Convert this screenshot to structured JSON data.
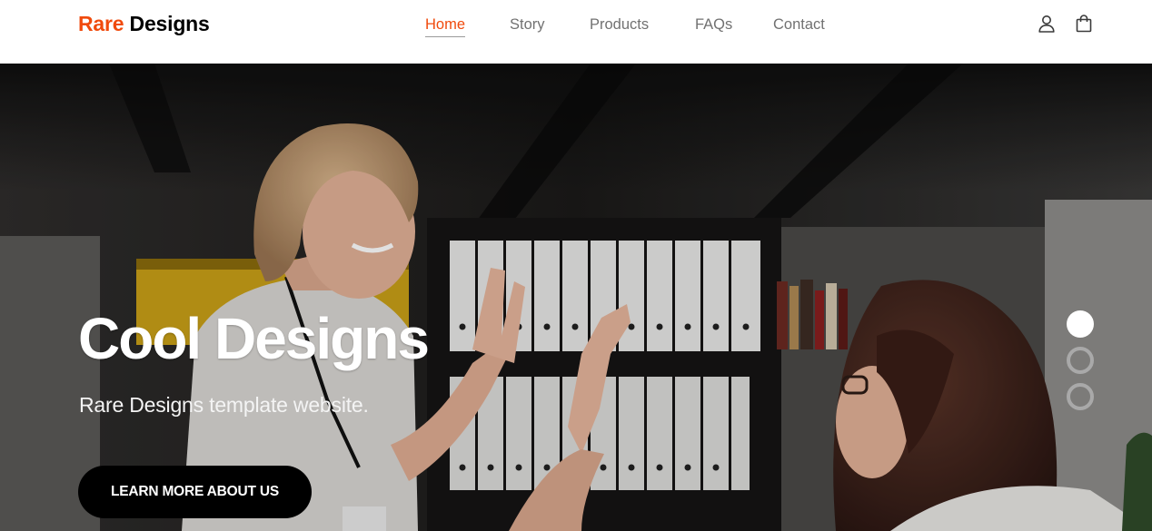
{
  "brand": {
    "accent": "Rare",
    "rest": " Designs"
  },
  "nav": {
    "items": [
      {
        "label": "Home",
        "active": true
      },
      {
        "label": "Story"
      },
      {
        "label": "Products"
      },
      {
        "label": "FAQs"
      },
      {
        "label": "Contact"
      }
    ]
  },
  "header_icons": [
    "user-icon",
    "shopping-bag-icon"
  ],
  "hero": {
    "title": "Cool Designs",
    "subtitle": "Rare Designs template website.",
    "cta": "LEARN MORE ABOUT US",
    "slides": {
      "count": 3,
      "active": 1
    }
  },
  "colors": {
    "accent": "#f04a0c",
    "nav_text": "#717171",
    "button_bg": "#000000",
    "text_light": "#ffffff"
  }
}
